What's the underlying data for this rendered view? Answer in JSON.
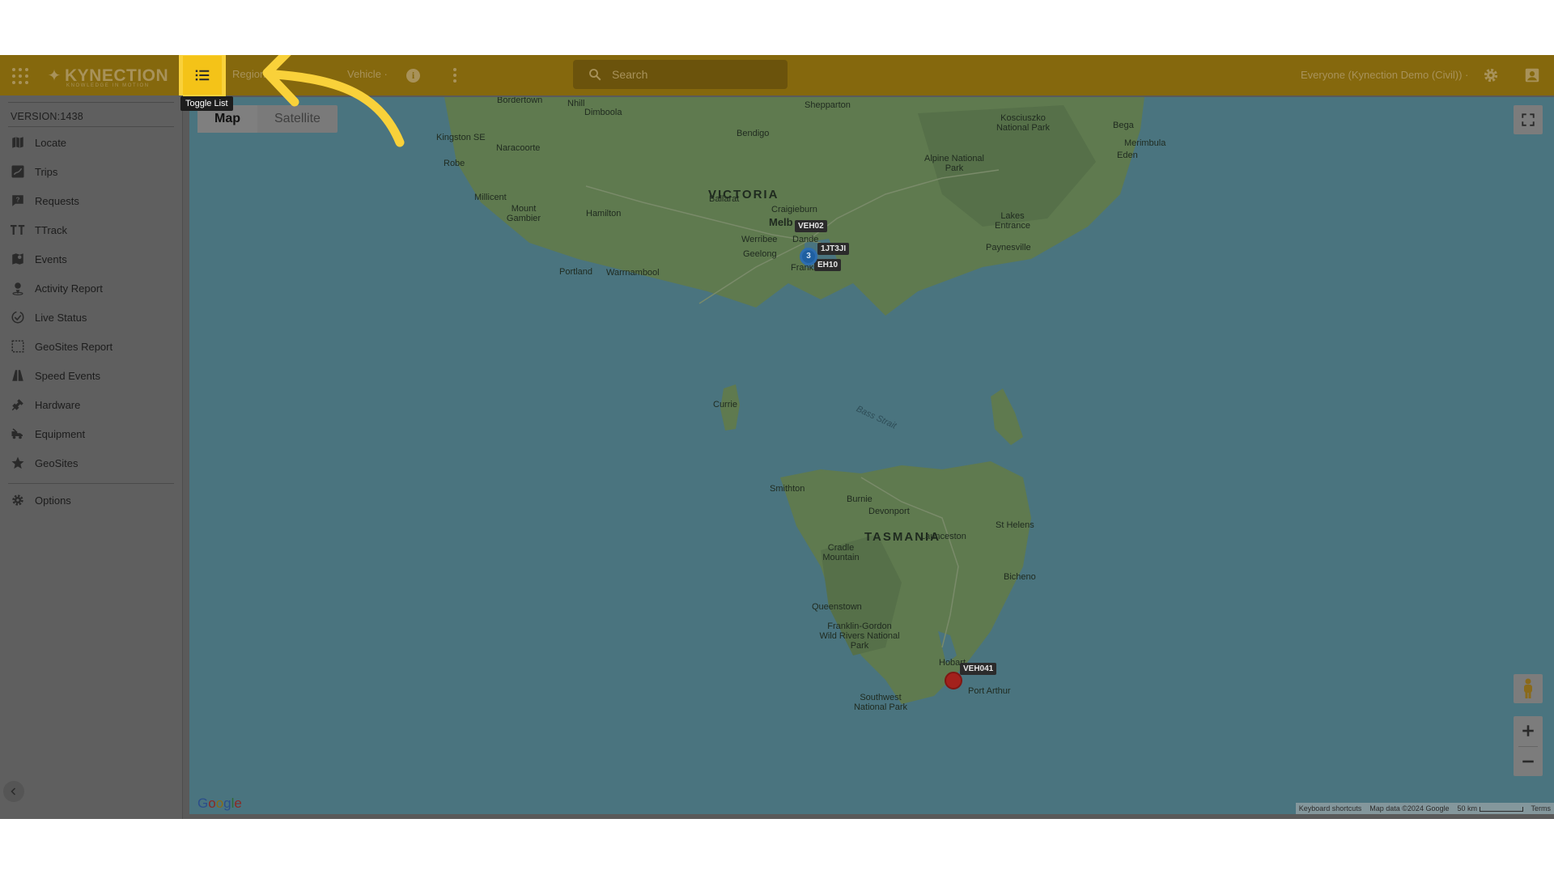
{
  "header": {
    "logo_text": "KYNECTION",
    "logo_tagline": "KNOWLEDGE IN MOTION",
    "toggle_list_tooltip": "Toggle List",
    "region_dropdown": "Region ·",
    "vehicle_dropdown": "Vehicle ·",
    "search_placeholder": "Search",
    "account_dropdown": "Everyone (Kynection Demo (Civil)) ·"
  },
  "sidebar": {
    "version": "VERSION:1438",
    "items": [
      {
        "label": "Locate",
        "icon": "map-icon"
      },
      {
        "label": "Trips",
        "icon": "route-icon"
      },
      {
        "label": "Requests",
        "icon": "request-icon"
      },
      {
        "label": "TTrack",
        "icon": "ttrack-icon"
      },
      {
        "label": "Events",
        "icon": "map-pin-icon"
      },
      {
        "label": "Activity Report",
        "icon": "person-pin-icon"
      },
      {
        "label": "Live Status",
        "icon": "check-circle-icon"
      },
      {
        "label": "GeoSites Report",
        "icon": "dashed-square-icon"
      },
      {
        "label": "Speed Events",
        "icon": "road-icon"
      },
      {
        "label": "Hardware",
        "icon": "plug-icon"
      },
      {
        "label": "Equipment",
        "icon": "truck-icon"
      },
      {
        "label": "GeoSites",
        "icon": "star-icon"
      }
    ],
    "options_label": "Options"
  },
  "map": {
    "map_button": "Map",
    "satellite_button": "Satellite",
    "regions": [
      "VICTORIA",
      "TASMANIA"
    ],
    "places": [
      "Bordertown",
      "Nhill",
      "Dimboola",
      "Shepparton",
      "Kosciuszko National Park",
      "Bega",
      "Merimbula",
      "Eden",
      "Kingston SE",
      "Naracoorte",
      "Bendigo",
      "Alpine National Park",
      "Robe",
      "Ballarat",
      "Craigieburn",
      "Lakes Entrance",
      "Millicent",
      "Mount Gambier",
      "Hamilton",
      "Melb",
      "Dande",
      "Paynesville",
      "Werribee",
      "Geelong",
      "Frankston",
      "Portland",
      "Warrnambool",
      "Currie",
      "Bass Strait",
      "Smithton",
      "Burnie",
      "Devonport",
      "St Helens",
      "Cradle Mountain",
      "Launceston",
      "Bicheno",
      "Queenstown",
      "Franklin-Gordon Wild Rivers National Park",
      "Hobart",
      "Port Arthur",
      "Southwest National Park"
    ],
    "markers": {
      "veh02": "VEH02",
      "ljt3": "1JT3JI",
      "veh10": "EH10",
      "cluster_count": "3",
      "veh041": "VEH041"
    },
    "attribution": {
      "shortcuts": "Keyboard shortcuts",
      "map_data": "Map data ©2024 Google",
      "scale": "50 km",
      "terms": "Terms"
    },
    "google_logo": "Google"
  },
  "colors": {
    "header": "#85680d",
    "highlight": "#f4c318",
    "arrow": "#f9d13a",
    "sea": "#4a747f",
    "land": "#5f7a4f"
  }
}
